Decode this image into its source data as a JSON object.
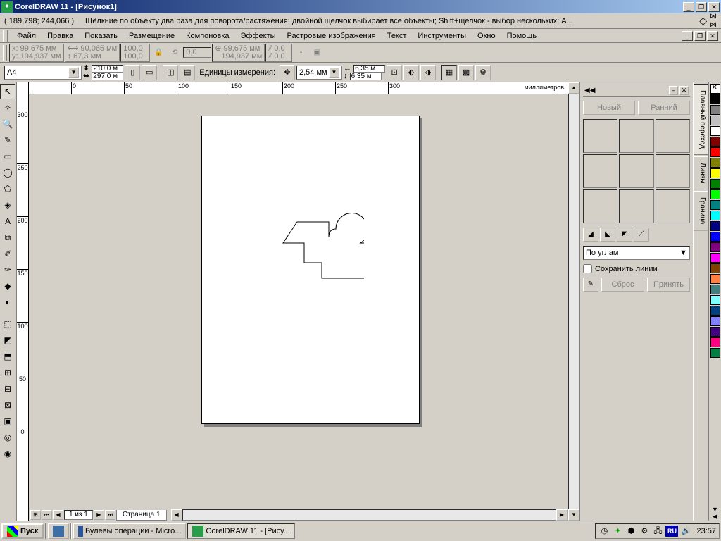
{
  "titlebar": {
    "app": "CorelDRAW 11",
    "doc": "[Рисунок1]"
  },
  "hint": {
    "coords": "( 189,798; 244,066 )",
    "text": "Щёлкние по объекту два раза для поворота/растяжения; двойной щелчок выбирает все объекты; Shift+щелчок - выбор нескольких; A..."
  },
  "menu": {
    "items": [
      "Файл",
      "Правка",
      "Показать",
      "Размещение",
      "Компоновка",
      "Эффекты",
      "Растровые изображения",
      "Текст",
      "Инструменты",
      "Окно",
      "Помощь"
    ]
  },
  "propbar": {
    "pos": {
      "x": "99,675 мм",
      "y": "194,937 мм"
    },
    "size": {
      "w": "90,065 мм",
      "h": "67,3 мм"
    },
    "scale": {
      "x": "100,0",
      "y": "100,0"
    },
    "rot": "0,0",
    "center": {
      "x": "99,675 мм",
      "y": "194,937 мм"
    },
    "skew": {
      "x": "0,0",
      "y": "0,0"
    }
  },
  "optbar": {
    "paper": "A4",
    "dims": {
      "w": "210,0 м",
      "h": "297,0 м"
    },
    "units_label": "Единицы измерения:",
    "nudge": "2,54 мм",
    "dup": {
      "x": "6,35 м",
      "y": "6,35 м"
    }
  },
  "ruler_unit": "миллиметров",
  "page_tab": "Страница 1",
  "page_info": "1 из 1",
  "docker": {
    "new_btn": "Новый",
    "recent_btn": "Ранний",
    "mode": "По углам",
    "keep_lines": "Сохранить линии",
    "reset": "Сброс",
    "apply": "Принять",
    "tabs": [
      "Плавный переход",
      "Линзы",
      "Граница"
    ]
  },
  "taskbar": {
    "start": "Пуск",
    "tasks": [
      "Булевы операции - Micro...",
      "CorelDRAW 11 - [Рису..."
    ],
    "lang": "RU",
    "clock": "23:57"
  },
  "colors": [
    "#000000",
    "#808080",
    "#c0c0c0",
    "#ffffff",
    "#800000",
    "#ff0000",
    "#808000",
    "#ffff00",
    "#008000",
    "#00ff00",
    "#008080",
    "#00ffff",
    "#000080",
    "#0000ff",
    "#800080",
    "#ff00ff",
    "#804000",
    "#ff8040",
    "#408080",
    "#80ffff",
    "#004080",
    "#8080ff",
    "#400080",
    "#ff0080",
    "#008040"
  ]
}
